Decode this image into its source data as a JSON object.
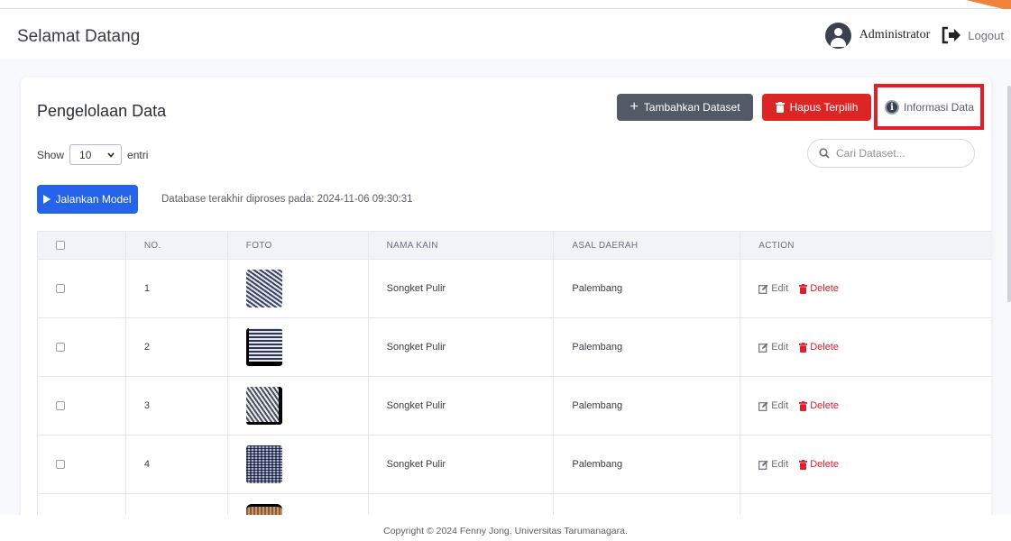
{
  "header": {
    "welcome": "Selamat Datang",
    "user": "Administrator",
    "logout": "Logout"
  },
  "card": {
    "title": "Pengelolaan Data",
    "add_button": "Tambahkan Dataset",
    "delete_button": "Hapus Terpilih",
    "info_button": "Informasi Data",
    "show_label": "Show",
    "entries_value": "10",
    "entries_label": "entri",
    "search_placeholder": "Cari Dataset...",
    "run_button": "Jalankan Model",
    "db_status": "Database terakhir diproses pada: 2024-11-06 09:30:31"
  },
  "table": {
    "headers": [
      "NO.",
      "FOTO",
      "NAMA KAIN",
      "ASAL DAERAH",
      "ACTION"
    ],
    "rows": [
      {
        "no": "1",
        "name": "Songket Pulir",
        "origin": "Palembang"
      },
      {
        "no": "2",
        "name": "Songket Pulir",
        "origin": "Palembang"
      },
      {
        "no": "3",
        "name": "Songket Pulir",
        "origin": "Palembang"
      },
      {
        "no": "4",
        "name": "Songket Pulir",
        "origin": "Palembang"
      }
    ],
    "edit_label": "Edit",
    "delete_label": "Delete"
  },
  "footer": {
    "copyright": "Copyright © 2024 Fenny Jong. Universitas Tarumanagara."
  },
  "colors": {
    "add_button": "#525a66",
    "delete_button": "#dc2626",
    "run_button": "#2563eb",
    "highlight_box": "#e41e26",
    "accent": "#f0823a"
  }
}
